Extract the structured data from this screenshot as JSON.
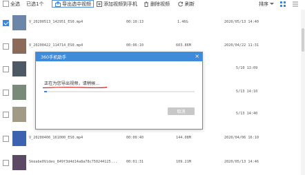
{
  "toolbar": {
    "select_all_label": "全选",
    "selected_count": "已选1个",
    "export_label": "导出选中视频",
    "add_label": "添加视频到手机",
    "delete_label": "删除视频",
    "refresh_label": "刷新",
    "sort_label": "排序"
  },
  "rows": [
    {
      "name": "V_20200513_142951_ES0.mp4",
      "duration": "00:10:13",
      "size": "1.46G",
      "date": "2020/05/13 14:40",
      "checked": true,
      "thumb_color": "#6b86a8"
    },
    {
      "name": "V_20200422_114714_ES0.mp4",
      "duration": "00:06:10",
      "size": "603.86M",
      "date": "2020/04/22 11:31",
      "checked": false,
      "thumb_color": "#8c6a5a"
    },
    {
      "name": "",
      "duration": "",
      "size": "",
      "date": "5/10 13:09",
      "checked": false,
      "thumb_color": "#4d5a66"
    },
    {
      "name": "",
      "duration": "",
      "size": "",
      "date": "5/13 14:10",
      "checked": false,
      "thumb_color": "#7a8a7a"
    },
    {
      "name": "",
      "duration": "",
      "size": "",
      "date": "5/13 14:40",
      "checked": false,
      "thumb_color": "#a09a86"
    },
    {
      "name": "V_20200406_161000_ES0.mp4",
      "duration": "00:00:40",
      "size": "144.08M",
      "date": "2020/04/06 16:10",
      "checked": false,
      "thumb_color": "#3c63b0"
    },
    {
      "name": "Skeabe0Video_849f3d4d14a8a78c750244125...",
      "duration": "00:01:31",
      "size": "109.21M",
      "date": "2020/05/13 14:46",
      "checked": false,
      "thumb_color": "#5c4a64"
    }
  ],
  "dialog": {
    "title": "360手机助手",
    "close": "×",
    "message": "正在为您导出视频，请稍候...",
    "progress": 0.02,
    "cancel_label": "取消"
  }
}
